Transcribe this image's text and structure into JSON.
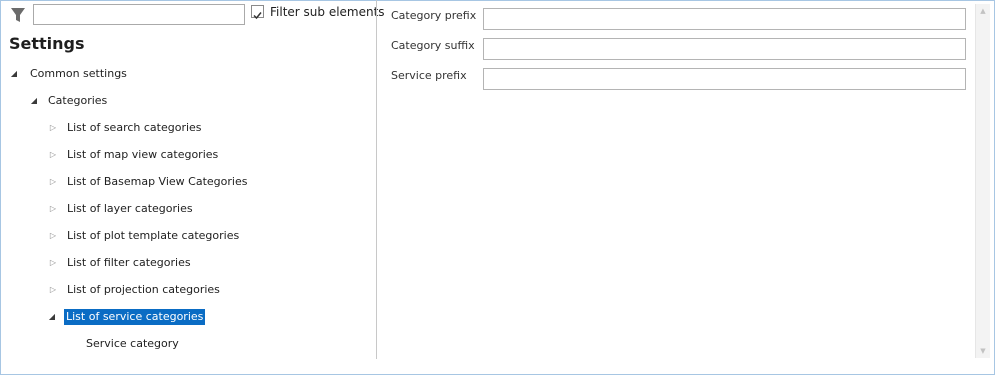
{
  "toolbar": {
    "filter_icon": "filter-funnel-icon",
    "search_value": "",
    "filter_sub_elements_label": "Filter sub elements",
    "filter_sub_elements_checked": true
  },
  "title": "Settings",
  "tree": {
    "common_settings": "Common settings",
    "categories": "Categories",
    "items": [
      "List of search categories",
      "List of map view categories",
      "List of Basemap View Categories",
      "List of layer categories",
      "List of plot template categories",
      "List of filter categories",
      "List of projection categories",
      "List of service categories"
    ],
    "selected_item": "List of service categories",
    "service_category": "Service category"
  },
  "form": {
    "category_prefix_label": "Category prefix",
    "category_prefix_value": "",
    "category_suffix_label": "Category suffix",
    "category_suffix_value": "",
    "service_prefix_label": "Service prefix",
    "service_prefix_value": ""
  },
  "colors": {
    "selection": "#0a6cc4",
    "frame_border": "#a7c6e3"
  }
}
